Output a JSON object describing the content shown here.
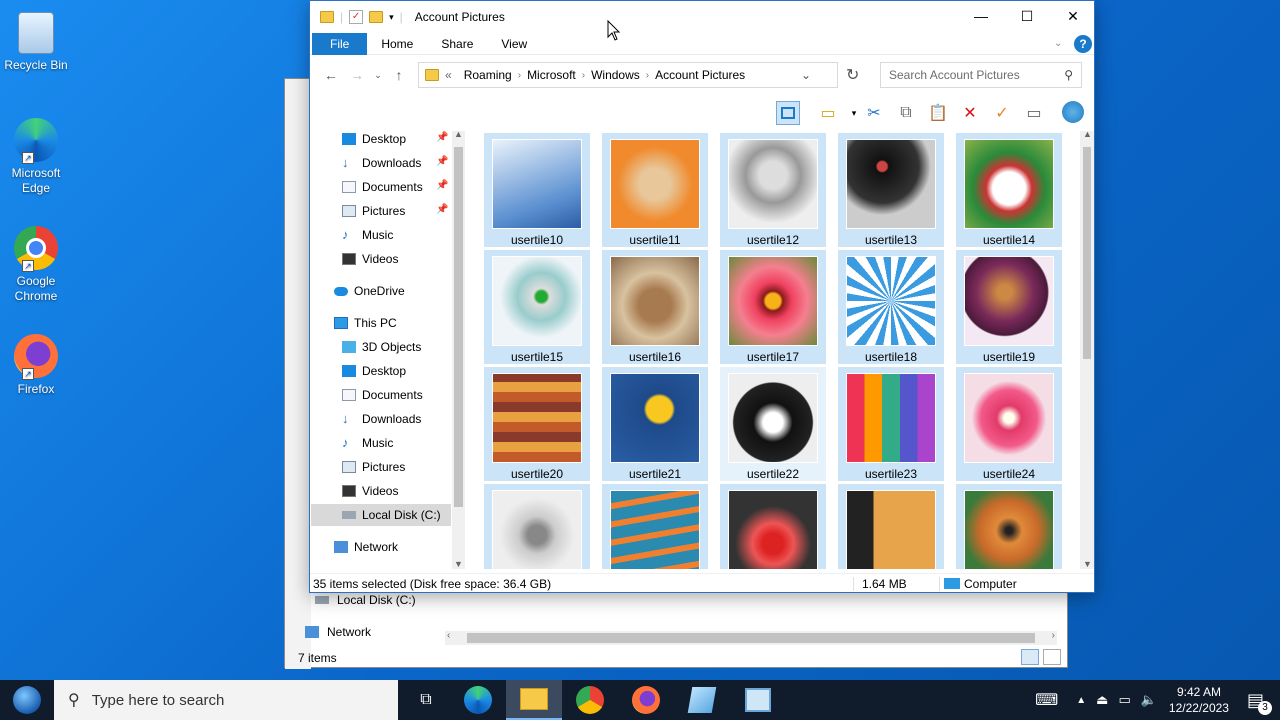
{
  "desktop": {
    "icons": [
      {
        "label": "Recycle Bin",
        "icon": "recycle-bin-icon"
      },
      {
        "label": "Microsoft Edge",
        "icon": "edge-icon"
      },
      {
        "label": "Google Chrome",
        "icon": "chrome-icon"
      },
      {
        "label": "Firefox",
        "icon": "firefox-icon"
      }
    ]
  },
  "window": {
    "title": "Account Pictures",
    "ribbon_tabs": {
      "file": "File",
      "home": "Home",
      "share": "Share",
      "view": "View"
    },
    "address": {
      "overflow": "«",
      "crumbs": [
        "Roaming",
        "Microsoft",
        "Windows",
        "Account Pictures"
      ]
    },
    "search_placeholder": "Search Account Pictures",
    "nav": {
      "quick": [
        "Desktop",
        "Downloads",
        "Documents",
        "Pictures",
        "Music",
        "Videos"
      ],
      "onedrive": "OneDrive",
      "thispc": "This PC",
      "pc_items": [
        "3D Objects",
        "Desktop",
        "Documents",
        "Downloads",
        "Music",
        "Pictures",
        "Videos",
        "Local Disk (C:)"
      ],
      "network": "Network"
    },
    "tiles": [
      "usertile10",
      "usertile11",
      "usertile12",
      "usertile13",
      "usertile14",
      "usertile15",
      "usertile16",
      "usertile17",
      "usertile18",
      "usertile19",
      "usertile20",
      "usertile21",
      "usertile22",
      "usertile23",
      "usertile24"
    ],
    "status": {
      "selected": "35 items selected (Disk free space: 36.4 GB)",
      "size": "1.64 MB",
      "location": "Computer"
    }
  },
  "backwindow": {
    "local_disk": "Local Disk (C:)",
    "network": "Network",
    "count": "7 items"
  },
  "taskbar": {
    "search_placeholder": "Type here to search",
    "time": "9:42 AM",
    "date": "12/22/2023",
    "notifications": "3"
  },
  "colors": {
    "accent": "#1979ca",
    "selection": "#cce4f7",
    "taskbar": "#101c2c"
  }
}
